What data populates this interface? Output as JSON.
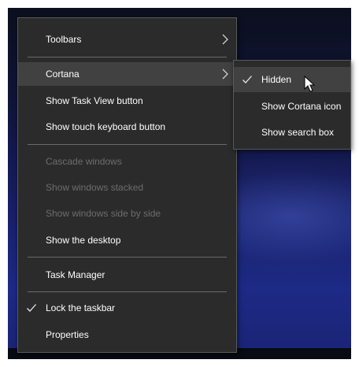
{
  "menu": {
    "items": [
      {
        "label": "Toolbars"
      },
      {
        "label": "Cortana"
      },
      {
        "label": "Show Task View button"
      },
      {
        "label": "Show touch keyboard button"
      },
      {
        "label": "Cascade windows"
      },
      {
        "label": "Show windows stacked"
      },
      {
        "label": "Show windows side by side"
      },
      {
        "label": "Show the desktop"
      },
      {
        "label": "Task Manager"
      },
      {
        "label": "Lock the taskbar"
      },
      {
        "label": "Properties"
      }
    ]
  },
  "submenu": {
    "items": [
      {
        "label": "Hidden"
      },
      {
        "label": "Show Cortana icon"
      },
      {
        "label": "Show search box"
      }
    ]
  },
  "icons": {
    "chevron": "chevron-right-icon",
    "check": "checkmark-icon",
    "cursor": "mouse-pointer-icon"
  },
  "colors": {
    "menu_bg": "#2b2b2b",
    "hover_bg": "#414141",
    "disabled_text": "#6d6d6d",
    "text": "#ffffff"
  }
}
